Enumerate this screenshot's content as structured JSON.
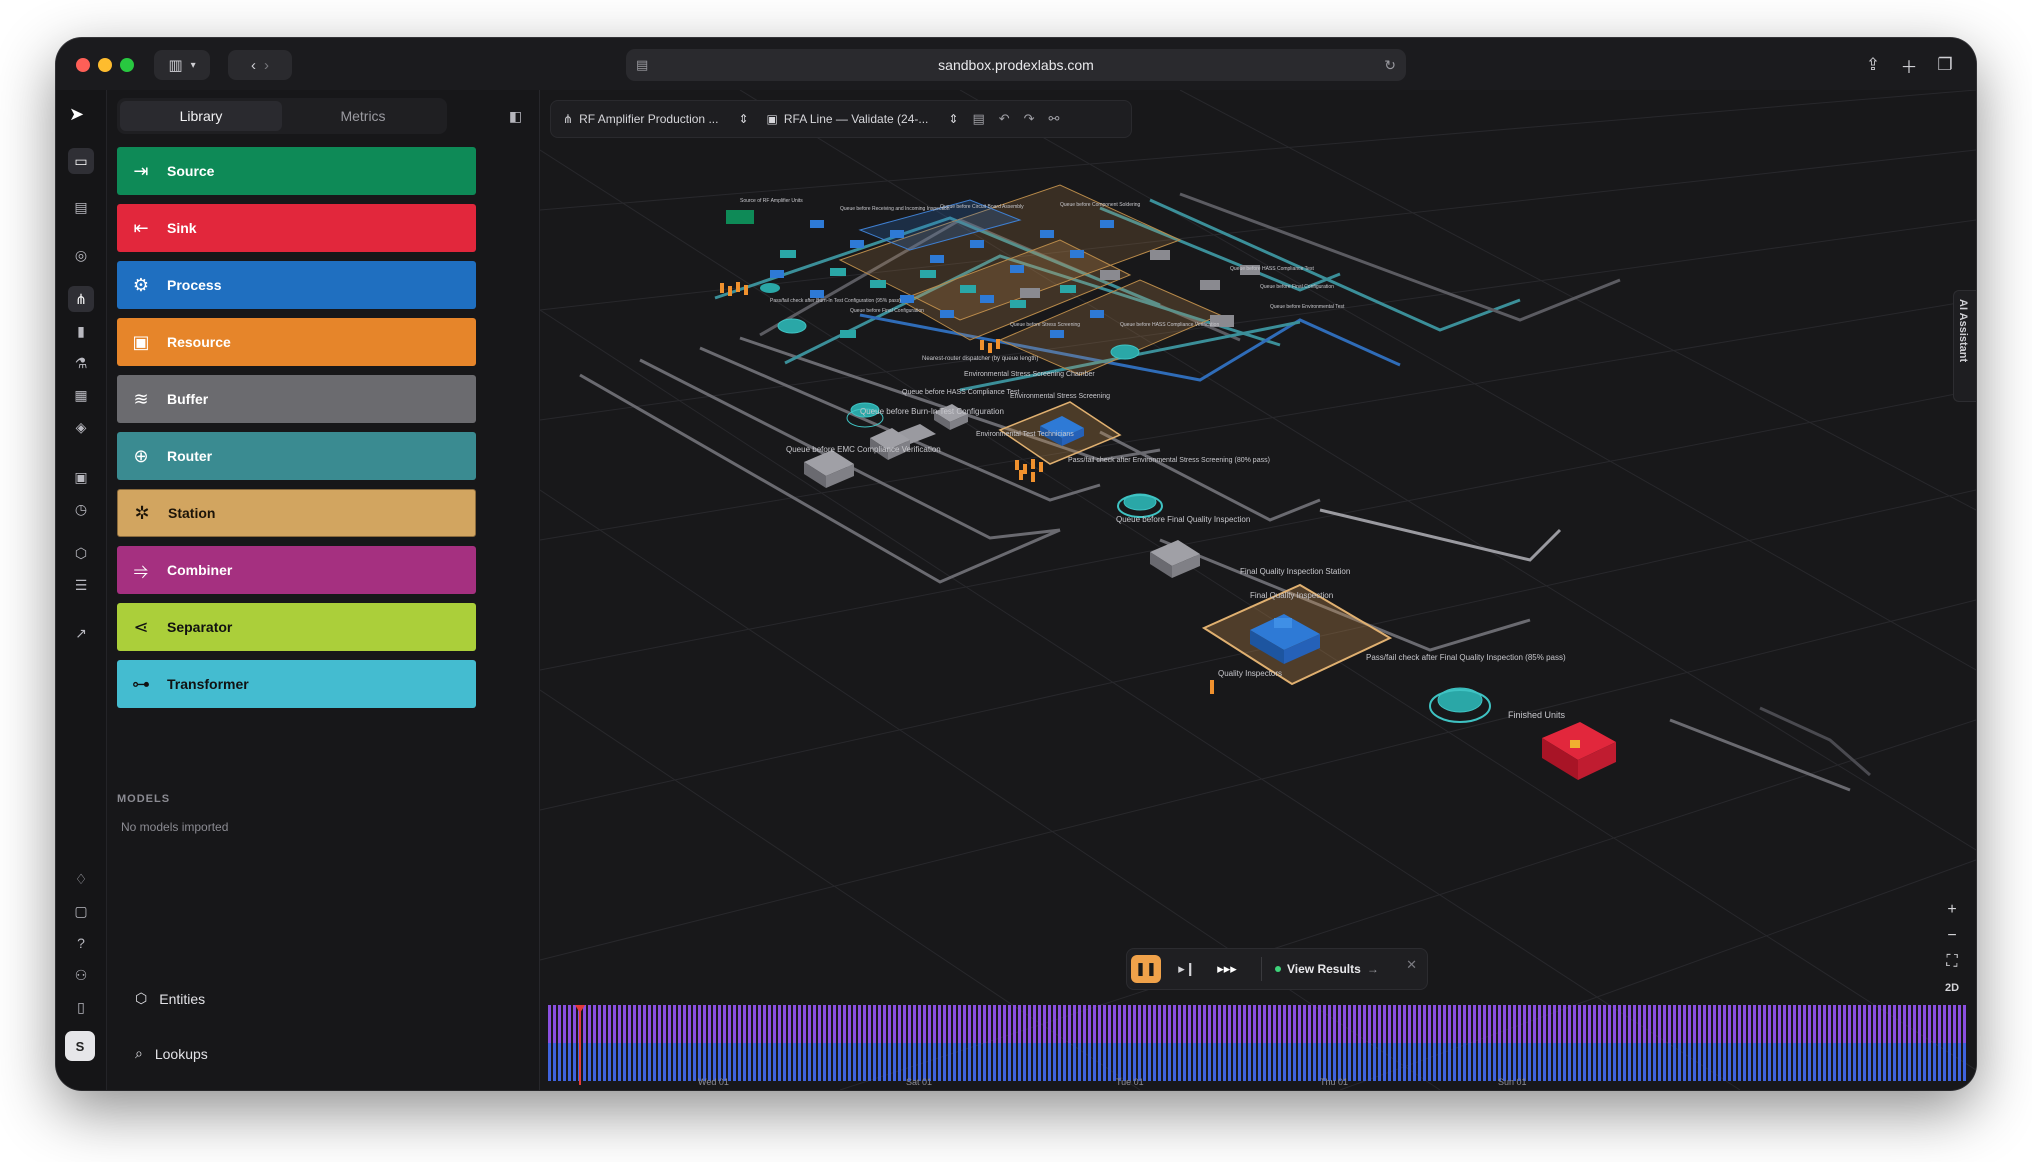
{
  "browser": {
    "url": "sandbox.prodexlabs.com"
  },
  "sidebar": {
    "tabs": [
      {
        "label": "Library"
      },
      {
        "label": "Metrics"
      }
    ],
    "library_items": [
      {
        "label": "Source",
        "icon": "log-in-icon",
        "color": "#0e8a57"
      },
      {
        "label": "Sink",
        "icon": "log-out-icon",
        "color": "#e2273c"
      },
      {
        "label": "Process",
        "icon": "gear-icon",
        "color": "#1f6fc0"
      },
      {
        "label": "Resource",
        "icon": "user-square-icon",
        "color": "#e6852a"
      },
      {
        "label": "Buffer",
        "icon": "layers-icon",
        "color": "#6b6b6f"
      },
      {
        "label": "Router",
        "icon": "globe-grid-icon",
        "color": "#3a8b91"
      },
      {
        "label": "Station",
        "icon": "cog-station-icon",
        "color": "#d2a560"
      },
      {
        "label": "Combiner",
        "icon": "merge-icon",
        "color": "#a53080"
      },
      {
        "label": "Separator",
        "icon": "split-icon",
        "color": "#abcf3a"
      },
      {
        "label": "Transformer",
        "icon": "transform-icon",
        "color": "#44bcd0"
      }
    ],
    "models_heading": "MODELS",
    "models_empty": "No models imported",
    "footer": [
      {
        "label": "Entities",
        "icon": "cube-icon"
      },
      {
        "label": "Lookups",
        "icon": "table-search-icon"
      }
    ]
  },
  "rail": {
    "avatar_initial": "S"
  },
  "toolbar": {
    "project": "RF Amplifier Production ...",
    "scenario": "RFA Line — Validate (24-..."
  },
  "canvas": {
    "ai_assistant": "AI Assistant",
    "zoom_2d": "2D",
    "labels": {
      "queue_emc": "Queue before EMC Compliance Verification",
      "queue_burn": "Queue before Burn-In Test Configuration",
      "queue_hass": "Queue before HASS Compliance Test",
      "env_chamber": "Environmental Stress Screening Chamber",
      "env_station": "Environmental Stress Screening",
      "env_tech": "Environmental Test Technicians",
      "pass_env": "Pass/fail check after Environmental Stress Screening (80% pass)",
      "router_dispatch": "Nearest-router dispatcher (by queue length)",
      "queue_final": "Queue before Final Quality Inspection",
      "final_station": "Final Quality Inspection Station",
      "final_process": "Final Quality Inspection",
      "quality_inspectors": "Quality Inspectors",
      "pass_final": "Pass/fail check after Final Quality Inspection (85% pass)",
      "finished": "Finished Units"
    }
  },
  "playback": {
    "view_results": "View Results"
  },
  "timeline": {
    "ticks": [
      "Wed 01",
      "Sat 01",
      "Tue 01",
      "Thu 01",
      "Sun 01"
    ],
    "colors": {
      "top": "#8a4fe0",
      "bottom": "#3f63dd",
      "playhead": "#e23a3a"
    }
  }
}
